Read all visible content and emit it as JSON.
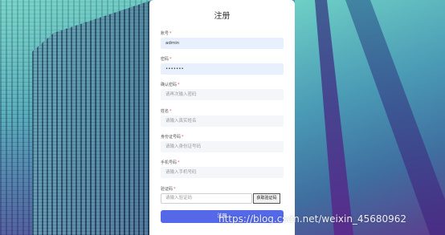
{
  "form": {
    "title": "注册",
    "username": {
      "label": "账号",
      "value": "admin"
    },
    "password": {
      "label": "密码",
      "value": "•••••••"
    },
    "confirm_password": {
      "label": "确认密码",
      "placeholder": "请再次输入密码"
    },
    "name": {
      "label": "姓名",
      "placeholder": "请输入真实姓名"
    },
    "id_number": {
      "label": "身份证号码",
      "placeholder": "请输入身份证号码"
    },
    "phone": {
      "label": "手机号码",
      "placeholder": "请输入手机号码"
    },
    "code": {
      "label": "验证码",
      "placeholder": "请输入验证码",
      "button": "获取验证码"
    },
    "required_mark": "*",
    "submit": "注册"
  },
  "watermark": "https://blog.csdn.net/weixin_45680962",
  "colors": {
    "accent": "#5468e8",
    "required": "#e55555"
  }
}
